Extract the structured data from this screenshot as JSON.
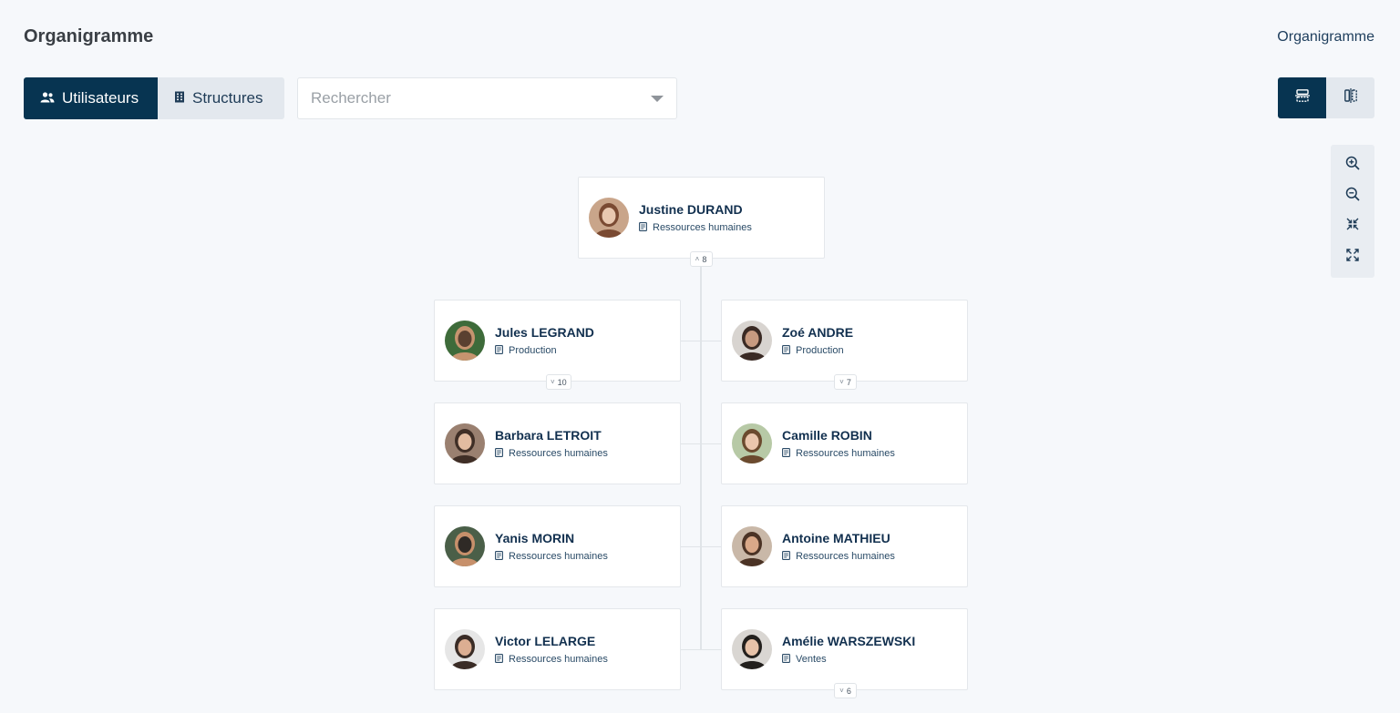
{
  "header": {
    "title": "Organigramme",
    "breadcrumb": "Organigramme"
  },
  "tabs": [
    {
      "label": "Utilisateurs",
      "icon": "users-icon",
      "active": true
    },
    {
      "label": "Structures",
      "icon": "building-icon",
      "active": false
    }
  ],
  "search": {
    "placeholder": "Rechercher",
    "value": ""
  },
  "layout_toggle": [
    {
      "icon": "vertical-layout-icon",
      "active": true
    },
    {
      "icon": "horizontal-layout-icon",
      "active": false
    }
  ],
  "zoom_controls": [
    "zoom-in-icon",
    "zoom-out-icon",
    "collapse-icon",
    "expand-icon"
  ],
  "colors": {
    "primary": "#073451",
    "secondary": "#e3e8ee",
    "text": "#12304f",
    "background": "#f6f8fb"
  },
  "org": {
    "root": {
      "name": "Justine DURAND",
      "department": "Ressources humaines",
      "reports": "8",
      "expanded": true
    },
    "children": [
      {
        "name": "Jules LEGRAND",
        "department": "Production",
        "reports": "10"
      },
      {
        "name": "Zoé ANDRE",
        "department": "Production",
        "reports": "7"
      },
      {
        "name": "Barbara LETROIT",
        "department": "Ressources humaines",
        "reports": null
      },
      {
        "name": "Camille ROBIN",
        "department": "Ressources humaines",
        "reports": null
      },
      {
        "name": "Yanis MORIN",
        "department": "Ressources humaines",
        "reports": null
      },
      {
        "name": "Antoine MATHIEU",
        "department": "Ressources humaines",
        "reports": null
      },
      {
        "name": "Victor LELARGE",
        "department": "Ressources humaines",
        "reports": null
      },
      {
        "name": "Amélie WARSZEWSKI",
        "department": "Ventes",
        "reports": "6"
      }
    ]
  }
}
